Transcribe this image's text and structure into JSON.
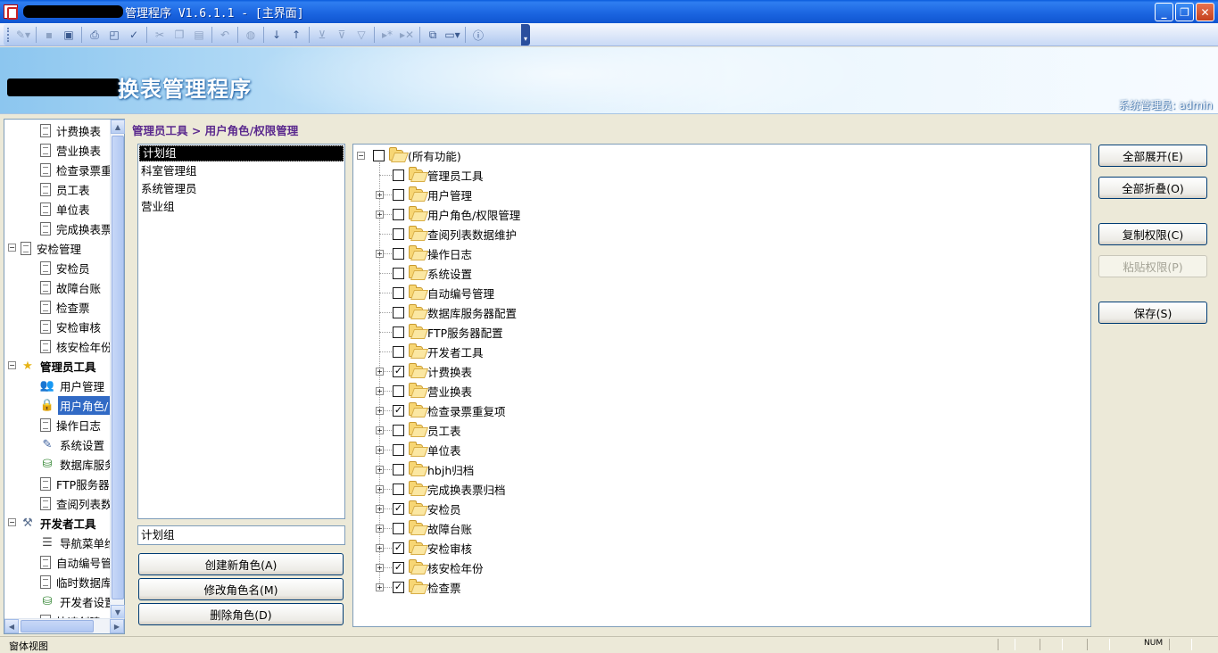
{
  "window": {
    "title": "管理程序 V1.6.1.1 - [主界面]",
    "buttons": {
      "minimize": "_",
      "restore": "❐",
      "close": "✕"
    }
  },
  "toolbar": {
    "icons": [
      "edit-icon",
      "save-icon",
      "save-as-icon",
      "print-icon",
      "print-preview-icon",
      "spellcheck-icon",
      "cut-icon",
      "copy-icon",
      "paste-icon",
      "undo-icon",
      "find-icon",
      "sort-asc-icon",
      "sort-desc-icon",
      "filter-icon",
      "filter-edit-icon",
      "filter-clear-icon",
      "nav-next-icon",
      "nav-delete-icon",
      "window-icon",
      "new-window-icon",
      "help-icon"
    ]
  },
  "banner": {
    "title": "换表管理程序",
    "user": "系统管理员: admin"
  },
  "nav": {
    "items": [
      {
        "label": "计费换表",
        "level": 2,
        "icon": "doc"
      },
      {
        "label": "营业换表",
        "level": 2,
        "icon": "doc"
      },
      {
        "label": "检查录票重",
        "level": 2,
        "icon": "doc"
      },
      {
        "label": "员工表",
        "level": 2,
        "icon": "doc"
      },
      {
        "label": "单位表",
        "level": 2,
        "icon": "doc"
      },
      {
        "label": "完成换表票",
        "level": 2,
        "icon": "doc"
      },
      {
        "label": "安检管理",
        "level": 1,
        "icon": "doc",
        "expander": "−"
      },
      {
        "label": "安检员",
        "level": 2,
        "icon": "doc"
      },
      {
        "label": "故障台账",
        "level": 2,
        "icon": "doc"
      },
      {
        "label": "检查票",
        "level": 2,
        "icon": "doc"
      },
      {
        "label": "安检审核",
        "level": 2,
        "icon": "doc"
      },
      {
        "label": "核安检年份",
        "level": 2,
        "icon": "doc"
      },
      {
        "label": "管理员工具",
        "level": 1,
        "icon": "star",
        "expander": "−",
        "bold": true
      },
      {
        "label": "用户管理",
        "level": 2,
        "icon": "users"
      },
      {
        "label": "用户角色/",
        "level": 2,
        "icon": "lock",
        "selected": true
      },
      {
        "label": "操作日志",
        "level": 2,
        "icon": "doc"
      },
      {
        "label": "系统设置",
        "level": 2,
        "icon": "settings"
      },
      {
        "label": "数据库服务",
        "level": 2,
        "icon": "db"
      },
      {
        "label": "FTP服务器",
        "level": 2,
        "icon": "doc"
      },
      {
        "label": "查阅列表数",
        "level": 2,
        "icon": "doc"
      },
      {
        "label": "开发者工具",
        "level": 1,
        "icon": "tools",
        "expander": "−",
        "bold": true
      },
      {
        "label": "导航菜单维",
        "level": 2,
        "icon": "list"
      },
      {
        "label": "自动编号管",
        "level": 2,
        "icon": "doc"
      },
      {
        "label": "临时数据库",
        "level": 2,
        "icon": "doc"
      },
      {
        "label": "开发者设置",
        "level": 2,
        "icon": "db"
      },
      {
        "label": "快速创建",
        "level": 2,
        "icon": "doc"
      }
    ]
  },
  "breadcrumb": "管理员工具 > 用户角色/权限管理",
  "roles": {
    "items": [
      "计划组",
      "科室管理组",
      "系统管理员",
      "营业组"
    ],
    "selected_index": 0,
    "name_value": "计划组",
    "create_label": "创建新角色(A)",
    "rename_label": "修改角色名(M)",
    "delete_label": "删除角色(D)"
  },
  "permissions": {
    "root": {
      "label": "(所有功能)",
      "checked": false
    },
    "nodes": [
      {
        "label": "管理员工具",
        "checked": false,
        "expandable": false
      },
      {
        "label": "用户管理",
        "checked": false,
        "expandable": true
      },
      {
        "label": "用户角色/权限管理",
        "checked": false,
        "expandable": true
      },
      {
        "label": "查阅列表数据维护",
        "checked": false,
        "expandable": false
      },
      {
        "label": "操作日志",
        "checked": false,
        "expandable": true
      },
      {
        "label": "系统设置",
        "checked": false,
        "expandable": false
      },
      {
        "label": "自动编号管理",
        "checked": false,
        "expandable": false
      },
      {
        "label": "数据库服务器配置",
        "checked": false,
        "expandable": false
      },
      {
        "label": "FTP服务器配置",
        "checked": false,
        "expandable": false
      },
      {
        "label": "开发者工具",
        "checked": false,
        "expandable": false
      },
      {
        "label": "计费换表",
        "checked": true,
        "expandable": true
      },
      {
        "label": "营业换表",
        "checked": false,
        "expandable": true
      },
      {
        "label": "检查录票重复项",
        "checked": true,
        "expandable": true
      },
      {
        "label": "员工表",
        "checked": false,
        "expandable": true
      },
      {
        "label": "单位表",
        "checked": false,
        "expandable": true
      },
      {
        "label": "hbjh归档",
        "checked": false,
        "expandable": true
      },
      {
        "label": "完成换表票归档",
        "checked": false,
        "expandable": true
      },
      {
        "label": "安检员",
        "checked": true,
        "expandable": true
      },
      {
        "label": "故障台账",
        "checked": false,
        "expandable": true
      },
      {
        "label": "安检审核",
        "checked": true,
        "expandable": true
      },
      {
        "label": "核安检年份",
        "checked": true,
        "expandable": true
      },
      {
        "label": "检查票",
        "checked": true,
        "expandable": true
      }
    ]
  },
  "actions": {
    "expand_all": "全部展开(E)",
    "collapse_all": "全部折叠(O)",
    "copy_perms": "复制权限(C)",
    "paste_perms": "粘贴权限(P)",
    "save": "保存(S)"
  },
  "statusbar": {
    "text": "窗体视图",
    "num": "NUM"
  }
}
